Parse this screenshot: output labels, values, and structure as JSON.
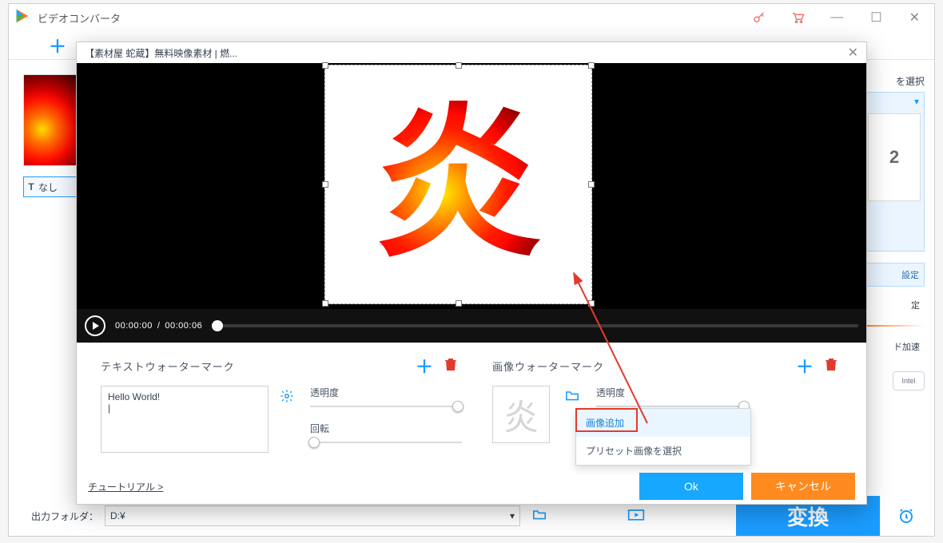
{
  "app": {
    "title": "ビデオコンバータ"
  },
  "main": {
    "subtitle_strip": "なし",
    "right_label_select": "を選択",
    "format_badge": "2",
    "right_btn1": "設定",
    "right_btn2": "定",
    "right_btn3": "ド加速",
    "intel": "Intel"
  },
  "bottombar": {
    "label": "出力フォルダ：",
    "path": "D:¥",
    "convert": "変換"
  },
  "editor": {
    "title": "【素材屋 蛇蔵】無料映像素材 | 燃...",
    "glyph": "炎",
    "time_cur": "00:00:00",
    "time_sep": "/",
    "time_total": "00:00:06",
    "text_wm_title": "テキストウォーターマーク",
    "img_wm_title": "画像ウォーターマーク",
    "textarea_value": "Hello World!",
    "opacity_label": "透明度",
    "rotate_label": "回転",
    "img_opacity_label": "透明度",
    "dd_add_image": "画像追加",
    "dd_preset": "プリセット画像を選択",
    "tutorial": "チュートリアル >",
    "ok": "Ok",
    "cancel": "キャンセル"
  }
}
